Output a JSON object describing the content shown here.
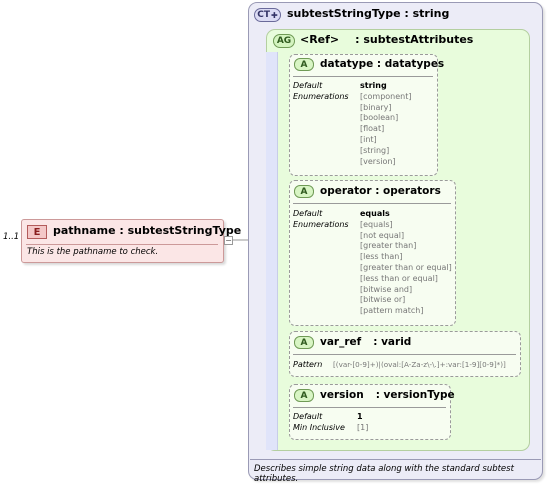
{
  "complex_type": {
    "badge": "CT",
    "title": "subtestStringType : string",
    "documentation": "Describes simple string data along with the standard subtest attributes."
  },
  "attribute_group": {
    "badge": "AG",
    "ref_label": "<Ref>",
    "name": ": subtestAttributes"
  },
  "attributes": [
    {
      "badge": "A",
      "name": "datatype",
      "type": ": datatypes",
      "labels": [
        "Default",
        "Enumerations"
      ],
      "default": "string",
      "values": [
        "[component]",
        "[binary]",
        "[boolean]",
        "[float]",
        "[int]",
        "[string]",
        "[version]"
      ]
    },
    {
      "badge": "A",
      "name": "operator",
      "type": ": operators",
      "labels": [
        "Default",
        "Enumerations"
      ],
      "default": "equals",
      "values": [
        "[equals]",
        "[not equal]",
        "[greater than]",
        "[less than]",
        "[greater than or equal]",
        "[less than or equal]",
        "[bitwise and]",
        "[bitwise or]",
        "[pattern match]"
      ]
    },
    {
      "badge": "A",
      "name": "var_ref",
      "type": ": varid",
      "labels": [
        "Pattern"
      ],
      "pattern": "[(var-[0-9]+)|(oval:[A-Za-z\\-\\.]+:var:[1-9][0-9]*)]"
    },
    {
      "badge": "A",
      "name": "version",
      "type": ": versionType",
      "labels": [
        "Default",
        "Min Inclusive"
      ],
      "default": "1",
      "values": [
        "[1]"
      ]
    }
  ],
  "element": {
    "badge": "E",
    "name": "pathname",
    "type": ": subtestStringType",
    "documentation": "This is the pathname to check.",
    "cardinality": "1..1",
    "collapse_symbol": "−"
  },
  "colors": {
    "complex_type_bg": "#ececf7",
    "attribute_group_bg": "#e8fcdc",
    "element_bg": "#fbe6e6"
  }
}
